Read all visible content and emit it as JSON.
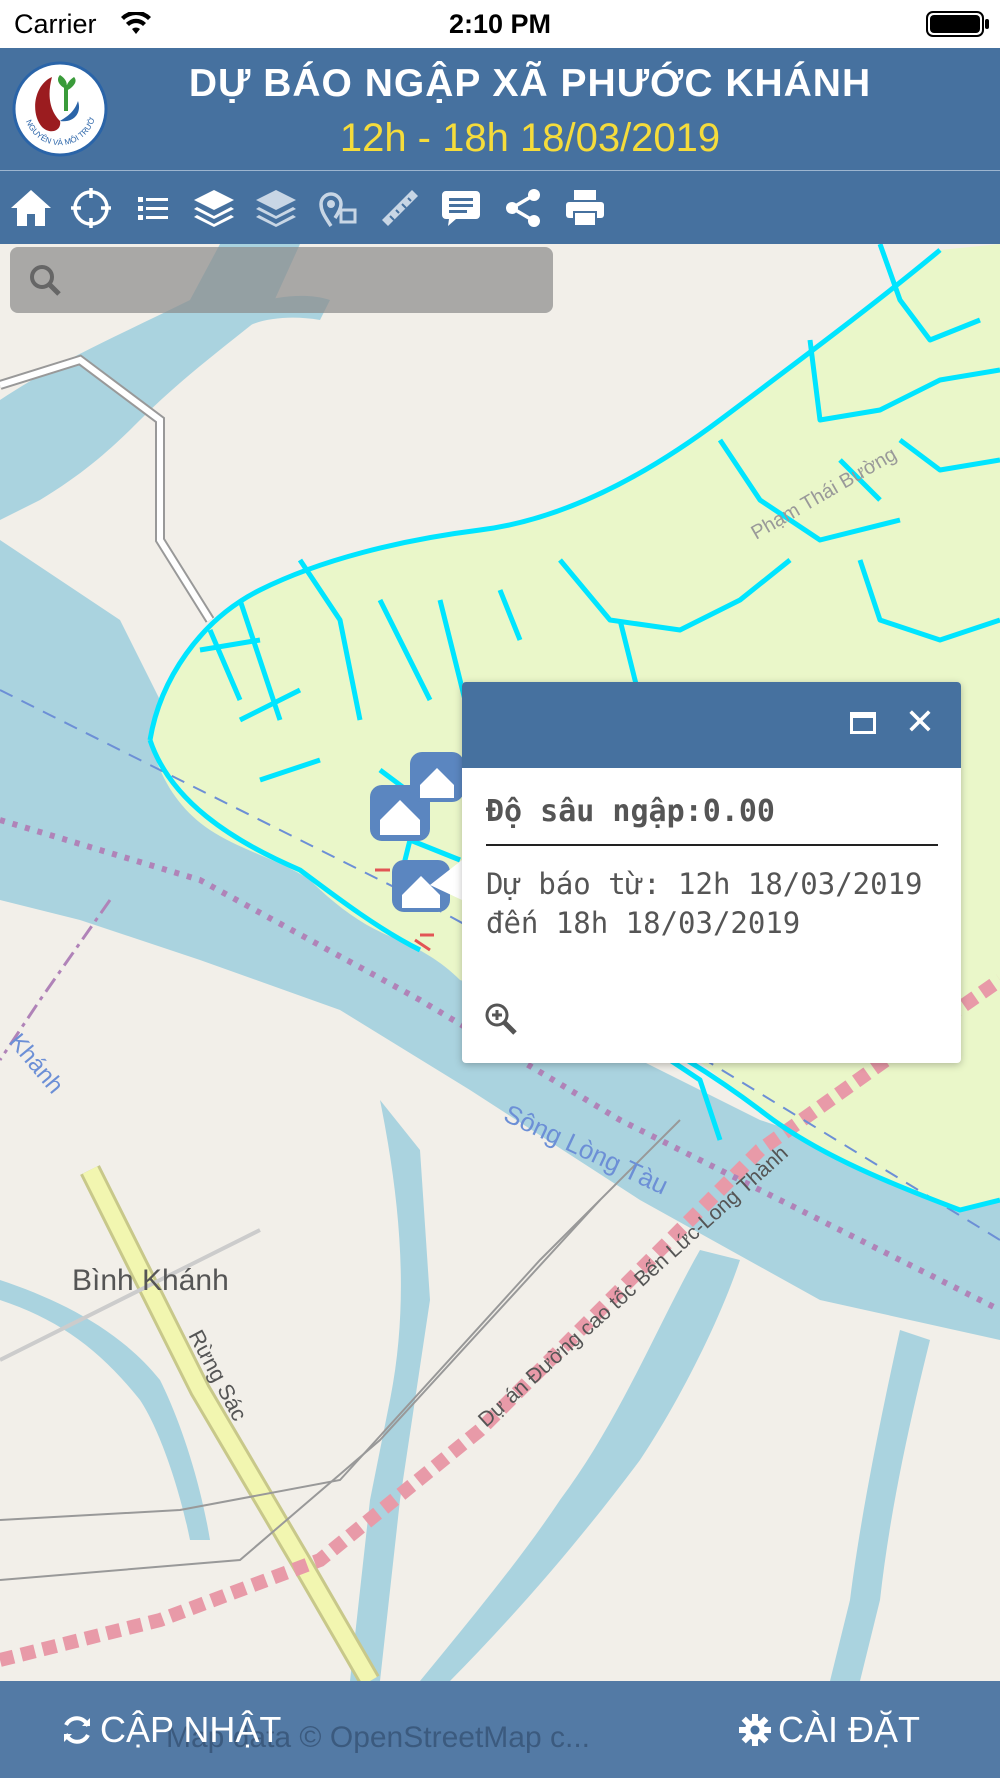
{
  "status_bar": {
    "carrier": "Carrier",
    "time": "2:10 PM"
  },
  "header": {
    "logo_text": "TÀI NGUYÊN VÀ MÔI TRƯỜNG",
    "title": "DỰ BÁO NGẬP XÃ PHƯỚC KHÁNH",
    "subtitle": "12h - 18h 18/03/2019",
    "title_color": "#ffffff",
    "subtitle_color": "#f5dc3b",
    "bar_color": "#46719f"
  },
  "toolbar": {
    "icons": [
      "home-icon",
      "locate-icon",
      "list-icon",
      "layers-icon",
      "basemap-icon",
      "identify-icon",
      "measure-icon",
      "comment-icon",
      "share-icon",
      "print-icon"
    ]
  },
  "search": {
    "placeholder": ""
  },
  "map": {
    "labels": {
      "binh_khanh": "Bình Khánh",
      "song_long_tau": "Sông Lòng Tàu",
      "rung_sac": "Rừng Sác",
      "highway": "Dự án Đường cao tốc Bến Lức-Long Thành",
      "pham_thai_buong": "Phạm Thái Bường",
      "khanh": "Khánh"
    },
    "flood_line_color": "#00e5ff",
    "flood_area_color": "#eaf7c9",
    "water_color": "#aad3df"
  },
  "popup": {
    "depth": "Độ sâu ngập:0.00",
    "forecast_line1": "Dự báo từ: 12h 18/03/2019",
    "forecast_line2": "đến 18h 18/03/2019"
  },
  "bottom_bar": {
    "update_label": "CẬP NHẬT",
    "settings_label": "CÀI ĐẶT",
    "attribution": "Map data © OpenStreetMap c..."
  }
}
